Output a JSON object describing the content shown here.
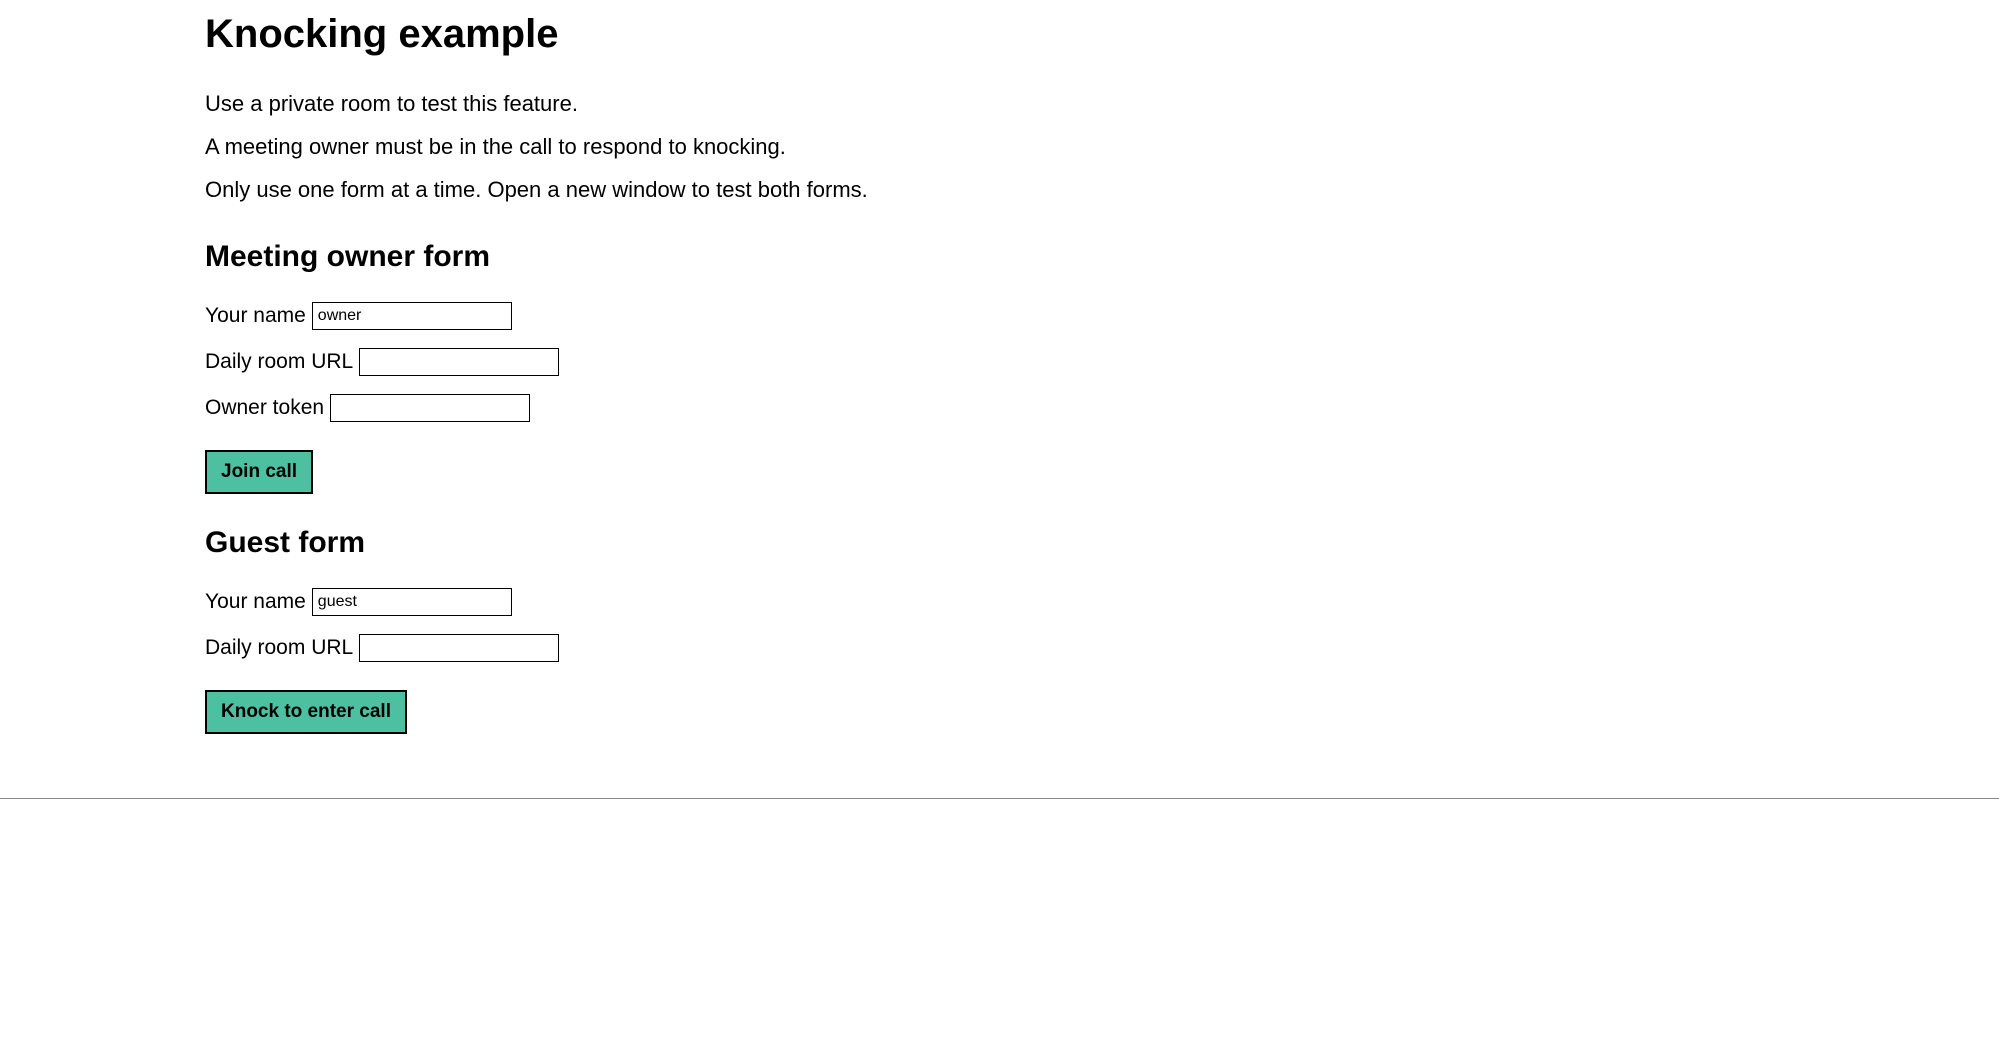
{
  "page": {
    "title": "Knocking example",
    "description": [
      "Use a private room to test this feature.",
      "A meeting owner must be in the call to respond to knocking.",
      "Only use one form at a time. Open a new window to test both forms."
    ]
  },
  "owner_form": {
    "heading": "Meeting owner form",
    "name_label": "Your name",
    "name_value": "owner",
    "url_label": "Daily room URL",
    "url_value": "",
    "token_label": "Owner token",
    "token_value": "",
    "submit_label": "Join call"
  },
  "guest_form": {
    "heading": "Guest form",
    "name_label": "Your name",
    "name_value": "guest",
    "url_label": "Daily room URL",
    "url_value": "",
    "submit_label": "Knock to enter call"
  },
  "colors": {
    "button_bg": "#4cc0a0"
  }
}
